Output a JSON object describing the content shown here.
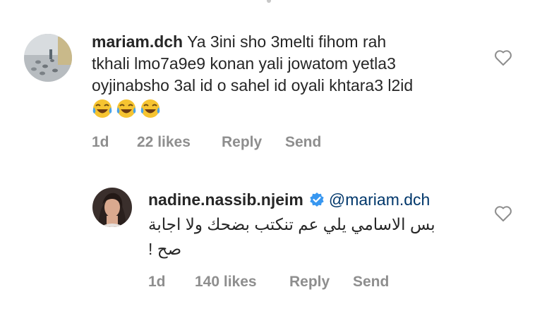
{
  "comments": [
    {
      "username": "mariam.dch",
      "text_line1": " Ya 3ini sho 3melti fihom rah",
      "text_line2": "tkhali lmo7a9e9 konan yali jowatom yetla3",
      "text_line3": "oyjinabsho 3al id o sahel id oyali khtara3 l2id",
      "emojis": [
        "face-with-tears-of-joy",
        "face-with-tears-of-joy",
        "face-with-tears-of-joy"
      ],
      "time": "1d",
      "likes": "22 likes",
      "reply_label": "Reply",
      "send_label": "Send"
    },
    {
      "username": "nadine.nassib.njeim",
      "mention": "@mariam.dch",
      "text_line1": "بس الاسامي يلي عم تنكتب بضحك ولا اجابة",
      "text_line2": "صح !",
      "time": "1d",
      "likes": "140 likes",
      "reply_label": "Reply",
      "send_label": "Send"
    }
  ],
  "colors": {
    "meta": "#8e8e8e",
    "mention": "#00376b",
    "verified": "#3897f0"
  }
}
